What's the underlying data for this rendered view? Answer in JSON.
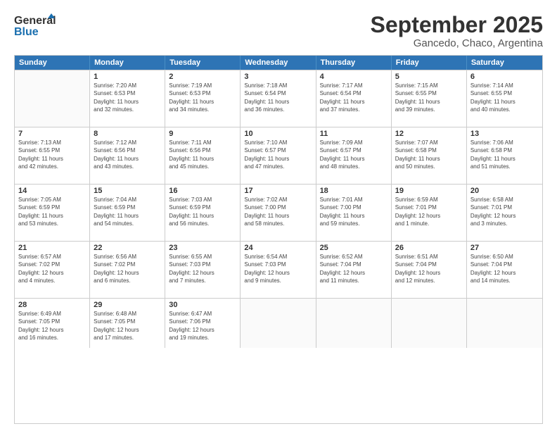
{
  "logo": {
    "line1": "General",
    "line2": "Blue"
  },
  "title": "September 2025",
  "subtitle": "Gancedo, Chaco, Argentina",
  "headers": [
    "Sunday",
    "Monday",
    "Tuesday",
    "Wednesday",
    "Thursday",
    "Friday",
    "Saturday"
  ],
  "weeks": [
    [
      {
        "day": "",
        "info": ""
      },
      {
        "day": "1",
        "info": "Sunrise: 7:20 AM\nSunset: 6:53 PM\nDaylight: 11 hours\nand 32 minutes."
      },
      {
        "day": "2",
        "info": "Sunrise: 7:19 AM\nSunset: 6:53 PM\nDaylight: 11 hours\nand 34 minutes."
      },
      {
        "day": "3",
        "info": "Sunrise: 7:18 AM\nSunset: 6:54 PM\nDaylight: 11 hours\nand 36 minutes."
      },
      {
        "day": "4",
        "info": "Sunrise: 7:17 AM\nSunset: 6:54 PM\nDaylight: 11 hours\nand 37 minutes."
      },
      {
        "day": "5",
        "info": "Sunrise: 7:15 AM\nSunset: 6:55 PM\nDaylight: 11 hours\nand 39 minutes."
      },
      {
        "day": "6",
        "info": "Sunrise: 7:14 AM\nSunset: 6:55 PM\nDaylight: 11 hours\nand 40 minutes."
      }
    ],
    [
      {
        "day": "7",
        "info": "Sunrise: 7:13 AM\nSunset: 6:55 PM\nDaylight: 11 hours\nand 42 minutes."
      },
      {
        "day": "8",
        "info": "Sunrise: 7:12 AM\nSunset: 6:56 PM\nDaylight: 11 hours\nand 43 minutes."
      },
      {
        "day": "9",
        "info": "Sunrise: 7:11 AM\nSunset: 6:56 PM\nDaylight: 11 hours\nand 45 minutes."
      },
      {
        "day": "10",
        "info": "Sunrise: 7:10 AM\nSunset: 6:57 PM\nDaylight: 11 hours\nand 47 minutes."
      },
      {
        "day": "11",
        "info": "Sunrise: 7:09 AM\nSunset: 6:57 PM\nDaylight: 11 hours\nand 48 minutes."
      },
      {
        "day": "12",
        "info": "Sunrise: 7:07 AM\nSunset: 6:58 PM\nDaylight: 11 hours\nand 50 minutes."
      },
      {
        "day": "13",
        "info": "Sunrise: 7:06 AM\nSunset: 6:58 PM\nDaylight: 11 hours\nand 51 minutes."
      }
    ],
    [
      {
        "day": "14",
        "info": "Sunrise: 7:05 AM\nSunset: 6:59 PM\nDaylight: 11 hours\nand 53 minutes."
      },
      {
        "day": "15",
        "info": "Sunrise: 7:04 AM\nSunset: 6:59 PM\nDaylight: 11 hours\nand 54 minutes."
      },
      {
        "day": "16",
        "info": "Sunrise: 7:03 AM\nSunset: 6:59 PM\nDaylight: 11 hours\nand 56 minutes."
      },
      {
        "day": "17",
        "info": "Sunrise: 7:02 AM\nSunset: 7:00 PM\nDaylight: 11 hours\nand 58 minutes."
      },
      {
        "day": "18",
        "info": "Sunrise: 7:01 AM\nSunset: 7:00 PM\nDaylight: 11 hours\nand 59 minutes."
      },
      {
        "day": "19",
        "info": "Sunrise: 6:59 AM\nSunset: 7:01 PM\nDaylight: 12 hours\nand 1 minute."
      },
      {
        "day": "20",
        "info": "Sunrise: 6:58 AM\nSunset: 7:01 PM\nDaylight: 12 hours\nand 3 minutes."
      }
    ],
    [
      {
        "day": "21",
        "info": "Sunrise: 6:57 AM\nSunset: 7:02 PM\nDaylight: 12 hours\nand 4 minutes."
      },
      {
        "day": "22",
        "info": "Sunrise: 6:56 AM\nSunset: 7:02 PM\nDaylight: 12 hours\nand 6 minutes."
      },
      {
        "day": "23",
        "info": "Sunrise: 6:55 AM\nSunset: 7:03 PM\nDaylight: 12 hours\nand 7 minutes."
      },
      {
        "day": "24",
        "info": "Sunrise: 6:54 AM\nSunset: 7:03 PM\nDaylight: 12 hours\nand 9 minutes."
      },
      {
        "day": "25",
        "info": "Sunrise: 6:52 AM\nSunset: 7:04 PM\nDaylight: 12 hours\nand 11 minutes."
      },
      {
        "day": "26",
        "info": "Sunrise: 6:51 AM\nSunset: 7:04 PM\nDaylight: 12 hours\nand 12 minutes."
      },
      {
        "day": "27",
        "info": "Sunrise: 6:50 AM\nSunset: 7:04 PM\nDaylight: 12 hours\nand 14 minutes."
      }
    ],
    [
      {
        "day": "28",
        "info": "Sunrise: 6:49 AM\nSunset: 7:05 PM\nDaylight: 12 hours\nand 16 minutes."
      },
      {
        "day": "29",
        "info": "Sunrise: 6:48 AM\nSunset: 7:05 PM\nDaylight: 12 hours\nand 17 minutes."
      },
      {
        "day": "30",
        "info": "Sunrise: 6:47 AM\nSunset: 7:06 PM\nDaylight: 12 hours\nand 19 minutes."
      },
      {
        "day": "",
        "info": ""
      },
      {
        "day": "",
        "info": ""
      },
      {
        "day": "",
        "info": ""
      },
      {
        "day": "",
        "info": ""
      }
    ]
  ]
}
